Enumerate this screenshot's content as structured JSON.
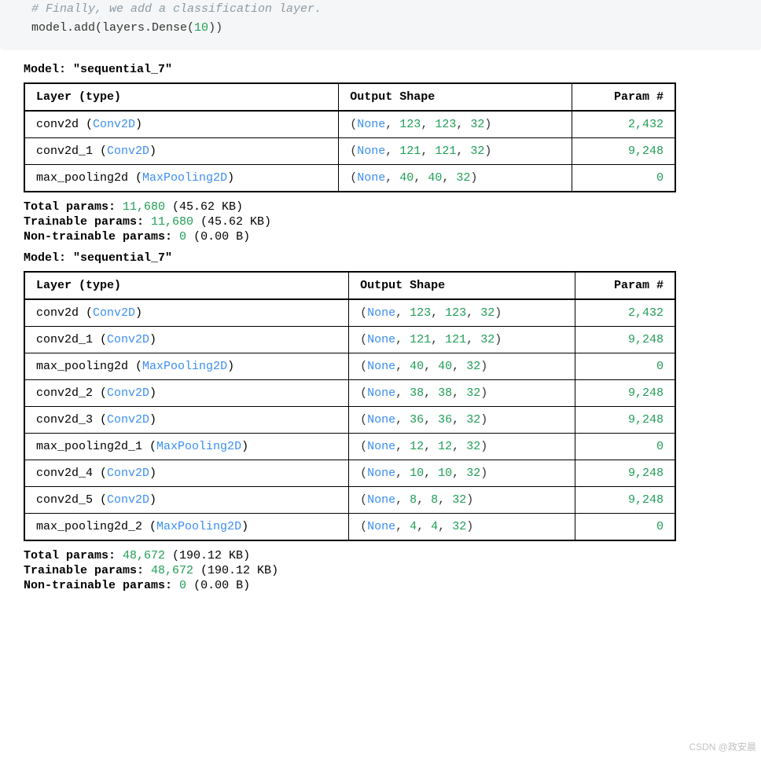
{
  "code": {
    "comment": "# Finally, we add a classification layer.",
    "line_p1": "model.add(layers.Dense(",
    "line_num": "10",
    "line_p2": "))"
  },
  "headers": {
    "layer": "Layer (type)",
    "shape": "Output Shape",
    "param": "Param #"
  },
  "model1": {
    "title_prefix": "Model: ",
    "title_name": "\"sequential_7\"",
    "rows": [
      {
        "name": "conv2d",
        "type": "Conv2D",
        "none": "None",
        "d1": "123",
        "d2": "123",
        "d3": "32",
        "param": "2,432"
      },
      {
        "name": "conv2d_1",
        "type": "Conv2D",
        "none": "None",
        "d1": "121",
        "d2": "121",
        "d3": "32",
        "param": "9,248"
      },
      {
        "name": "max_pooling2d",
        "type": "MaxPooling2D",
        "none": "None",
        "d1": "40",
        "d2": "40",
        "d3": "32",
        "param": "0"
      }
    ],
    "total_label": "Total params: ",
    "total_val": "11,680",
    "total_size": " (45.62 KB)",
    "train_label": "Trainable params: ",
    "train_val": "11,680",
    "train_size": " (45.62 KB)",
    "nontrain_label": "Non-trainable params: ",
    "nontrain_val": "0",
    "nontrain_size": " (0.00 B)"
  },
  "model2": {
    "title_prefix": "Model: ",
    "title_name": "\"sequential_7\"",
    "rows": [
      {
        "name": "conv2d",
        "type": "Conv2D",
        "none": "None",
        "d1": "123",
        "d2": "123",
        "d3": "32",
        "param": "2,432"
      },
      {
        "name": "conv2d_1",
        "type": "Conv2D",
        "none": "None",
        "d1": "121",
        "d2": "121",
        "d3": "32",
        "param": "9,248"
      },
      {
        "name": "max_pooling2d",
        "type": "MaxPooling2D",
        "none": "None",
        "d1": "40",
        "d2": "40",
        "d3": "32",
        "param": "0"
      },
      {
        "name": "conv2d_2",
        "type": "Conv2D",
        "none": "None",
        "d1": "38",
        "d2": "38",
        "d3": "32",
        "param": "9,248"
      },
      {
        "name": "conv2d_3",
        "type": "Conv2D",
        "none": "None",
        "d1": "36",
        "d2": "36",
        "d3": "32",
        "param": "9,248"
      },
      {
        "name": "max_pooling2d_1",
        "type": "MaxPooling2D",
        "none": "None",
        "d1": "12",
        "d2": "12",
        "d3": "32",
        "param": "0"
      },
      {
        "name": "conv2d_4",
        "type": "Conv2D",
        "none": "None",
        "d1": "10",
        "d2": "10",
        "d3": "32",
        "param": "9,248"
      },
      {
        "name": "conv2d_5",
        "type": "Conv2D",
        "none": "None",
        "d1": "8",
        "d2": "8",
        "d3": "32",
        "param": "9,248"
      },
      {
        "name": "max_pooling2d_2",
        "type": "MaxPooling2D",
        "none": "None",
        "d1": "4",
        "d2": "4",
        "d3": "32",
        "param": "0"
      }
    ],
    "total_label": "Total params: ",
    "total_val": "48,672",
    "total_size": " (190.12 KB)",
    "train_label": "Trainable params: ",
    "train_val": "48,672",
    "train_size": " (190.12 KB)",
    "nontrain_label": "Non-trainable params: ",
    "nontrain_val": "0",
    "nontrain_size": " (0.00 B)"
  },
  "watermark": "CSDN @政安晨"
}
